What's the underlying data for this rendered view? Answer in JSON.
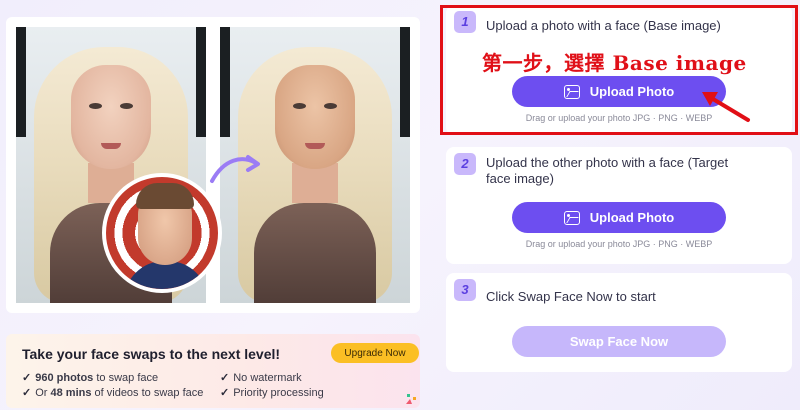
{
  "preview": {
    "before_label": "",
    "after_label": ""
  },
  "promo": {
    "title": "Take your face swaps to the next level!",
    "upgrade_label": "Upgrade Now",
    "features": {
      "photos_count": "960 photos",
      "photos_rest": " to swap face",
      "videos_prefix": "Or ",
      "videos_count": "48 mins",
      "videos_rest": " of videos to swap face",
      "no_watermark": "No watermark",
      "priority": "Priority processing"
    }
  },
  "steps": [
    {
      "number": "1",
      "text": "Upload a photo with a face (Base image)",
      "button_label": "Upload Photo",
      "hint": "Drag or upload your photo  JPG · PNG · WEBP"
    },
    {
      "number": "2",
      "text": "Upload the other photo with a face (Target face image)",
      "button_label": "Upload Photo",
      "hint": "Drag or upload your photo  JPG · PNG · WEBP"
    },
    {
      "number": "3",
      "text": "Click Swap Face Now to start",
      "button_label": "Swap Face Now"
    }
  ],
  "annotation": {
    "text": "第一步，選擇 Base image",
    "color": "#e10f16"
  },
  "colors": {
    "accent": "#6d4ef0",
    "accent_disabled": "#c6b7fb",
    "upgrade": "#fbbf24"
  }
}
